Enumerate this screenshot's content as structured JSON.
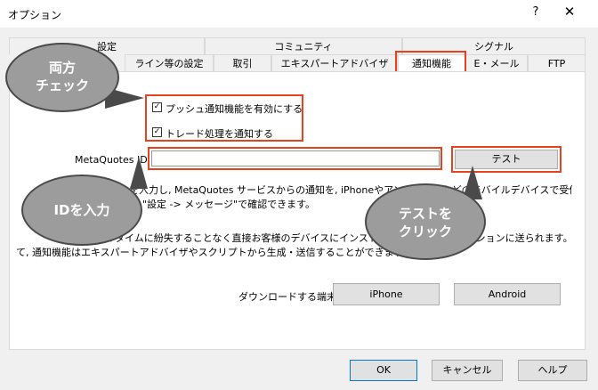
{
  "window": {
    "title": "オプション",
    "help": "?",
    "close": "✕"
  },
  "tabs_back": [
    "設定",
    "コミュニティ",
    "シグナル"
  ],
  "tabs_front": [
    "ライン等の設定",
    "取引",
    "エキスパートアドバイザ",
    "通知機能",
    "E・メール",
    "FTP"
  ],
  "active_tab": "通知機能",
  "notify": {
    "enable_push": {
      "label": "プッシュ通知機能を有効にする",
      "checked": true
    },
    "notify_trade": {
      "label": "トレード処理を通知する",
      "checked": true
    },
    "check_mark": "✓",
    "mq_label": "MetaQuotes ID",
    "mq_value": "",
    "test_label": "テスト",
    "desc1_line1": "を入力し, MetaQuotes サービスからの通知を, iPhoneやアンドロイドなどのモバイルデバイスで受信でき",
    "desc1_line2": "\"設定 -> メッセージ\"で確認できます。",
    "desc2_line1": "ルタイムに紛失することなく直接お客様のデバイスにインストールされたアプリケーションに送られます。そし",
    "desc2_line2": "て, 通知機能はエキスパートアドバイザやスクリプトから生成・送信することができます。",
    "download_label": "ダウンロードする端末:",
    "iphone": "iPhone",
    "android": "Android"
  },
  "footer": {
    "ok": "OK",
    "cancel": "キャンセル",
    "help": "ヘルプ"
  },
  "callouts": {
    "both_check": [
      "両方",
      "チェック"
    ],
    "enter_id": "IDを入力",
    "click_test": [
      "テストを",
      "クリック"
    ]
  },
  "colors": {
    "highlight": "#e8411e",
    "bubble_fill": "#9c9c9c",
    "bubble_border": "#4a4a4a"
  }
}
